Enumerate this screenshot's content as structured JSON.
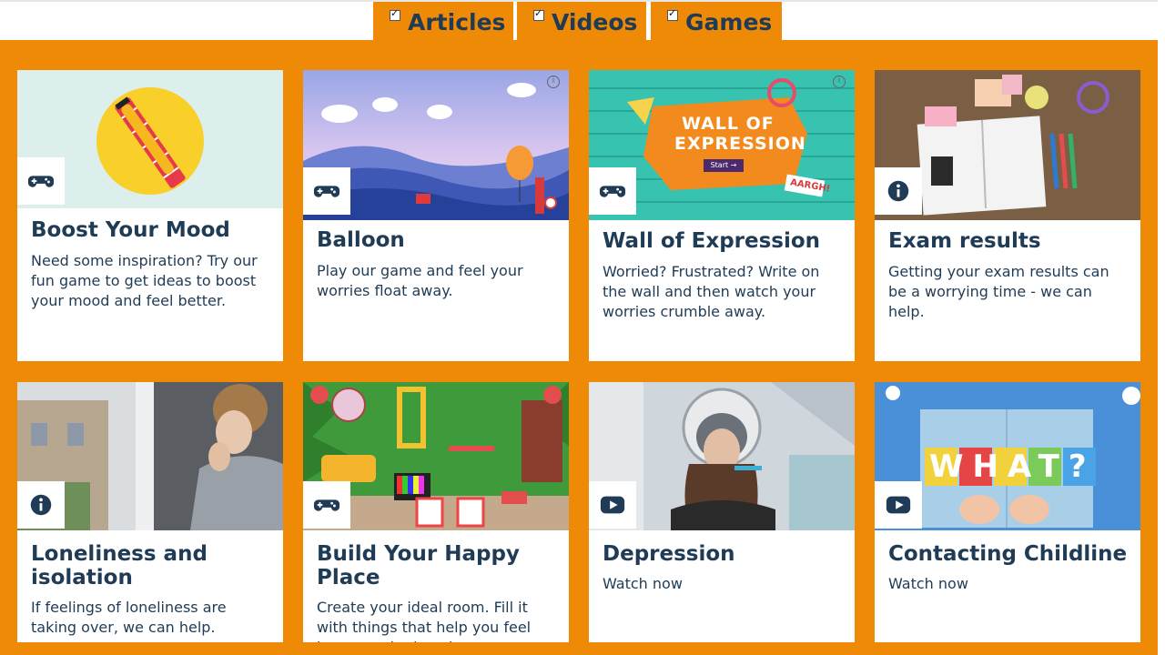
{
  "tabs": [
    {
      "label": "Articles",
      "checked": true
    },
    {
      "label": "Videos",
      "checked": true
    },
    {
      "label": "Games",
      "checked": true
    }
  ],
  "cards": [
    {
      "title": "Boost Your Mood",
      "desc": "Need some inspiration? Try our fun game to get ideas to boost your mood and feel better.",
      "icon": "gamepad-icon"
    },
    {
      "title": "Balloon",
      "desc": "Play our game and feel your worries float away.",
      "icon": "gamepad-icon"
    },
    {
      "title": "Wall of Expression",
      "desc": "Worried? Frustrated? Write on the wall and then watch your worries crumble away.",
      "icon": "gamepad-icon",
      "image_text": {
        "line1": "WALL OF",
        "line2": "EXPRESSION",
        "start": "Start →",
        "shout": "AARGH!"
      }
    },
    {
      "title": "Exam results",
      "desc": "Getting your exam results can be a worrying time - we can help.",
      "icon": "info-icon"
    },
    {
      "title": "Loneliness and isolation",
      "desc": "If feelings of loneliness are taking over, we can help.",
      "icon": "info-icon"
    },
    {
      "title": "Build Your Happy Place",
      "desc": "Create your ideal room. Fill it with things that help you feel happy and relaxed.",
      "icon": "gamepad-icon"
    },
    {
      "title": "Depression",
      "desc": "Watch now",
      "icon": "video-play-icon"
    },
    {
      "title": "Contacting Childline",
      "desc": "Watch now",
      "icon": "video-play-icon",
      "image_text": {
        "word": "WHAT?"
      }
    }
  ],
  "colors": {
    "brand_orange": "#ef8a07",
    "text_navy": "#1f3b55"
  }
}
